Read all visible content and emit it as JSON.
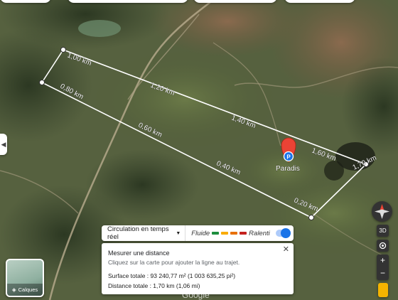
{
  "map": {
    "place_label": "Paradis",
    "segment_labels": [
      "1,00 km",
      "0,80 km",
      "1,20 km",
      "0,60 km",
      "1,40 km",
      "0,40 km",
      "1,60 km",
      "0,20 km",
      "1,70 km"
    ]
  },
  "traffic": {
    "dropdown_label": "Circulation en temps réel",
    "fast_label": "Fluide",
    "slow_label": "Ralenti",
    "colors": [
      "#1e8e3e",
      "#f9ab00",
      "#e8710a",
      "#c5221f",
      "#8b1a10"
    ]
  },
  "measure_panel": {
    "title": "Mesurer une distance",
    "hint": "Cliquez sur la carte pour ajouter la ligne au trajet.",
    "area": "Surface totale : 93 240,77 m² (1 003 635,25 pi²)",
    "distance": "Distance totale : 1,70 km (1,06 mi)"
  },
  "layers": {
    "label": "Calques"
  },
  "controls": {
    "three_d_label": "3D",
    "zoom_in": "+",
    "zoom_out": "−"
  },
  "brand": "Google"
}
